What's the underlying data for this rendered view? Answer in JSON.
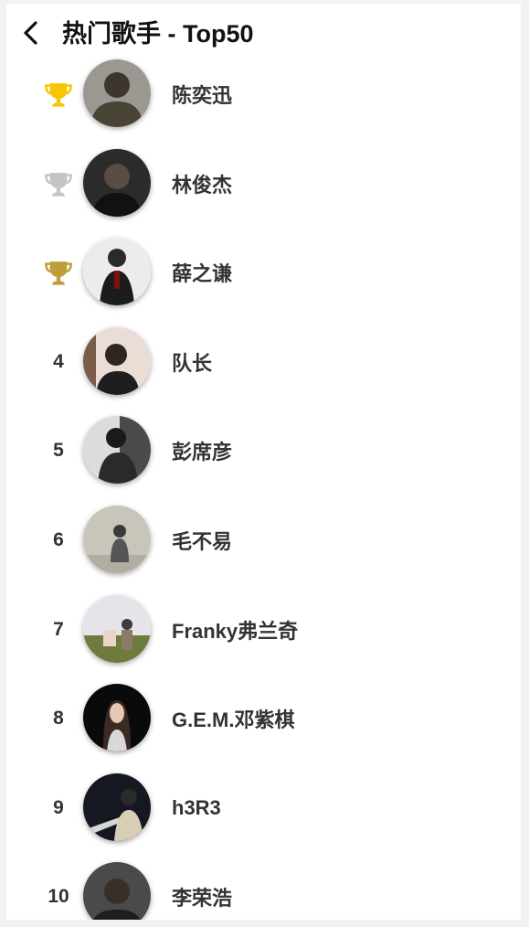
{
  "header": {
    "title": "热门歌手 - Top50",
    "back_icon": "chevron-left-icon"
  },
  "trophy_colors": {
    "gold": "#f7c600",
    "silver": "#c4c4c4",
    "bronze": "#bf9e3a"
  },
  "singers": [
    {
      "rank": "1",
      "name": "陈奕迅",
      "trophy": "gold"
    },
    {
      "rank": "2",
      "name": "林俊杰",
      "trophy": "silver"
    },
    {
      "rank": "3",
      "name": "薛之谦",
      "trophy": "bronze"
    },
    {
      "rank": "4",
      "name": "队长"
    },
    {
      "rank": "5",
      "name": "彭席彦"
    },
    {
      "rank": "6",
      "name": "毛不易"
    },
    {
      "rank": "7",
      "name": "Franky弗兰奇"
    },
    {
      "rank": "8",
      "name": "G.E.M.邓紫棋"
    },
    {
      "rank": "9",
      "name": "h3R3"
    },
    {
      "rank": "10",
      "name": "李荣浩"
    }
  ]
}
